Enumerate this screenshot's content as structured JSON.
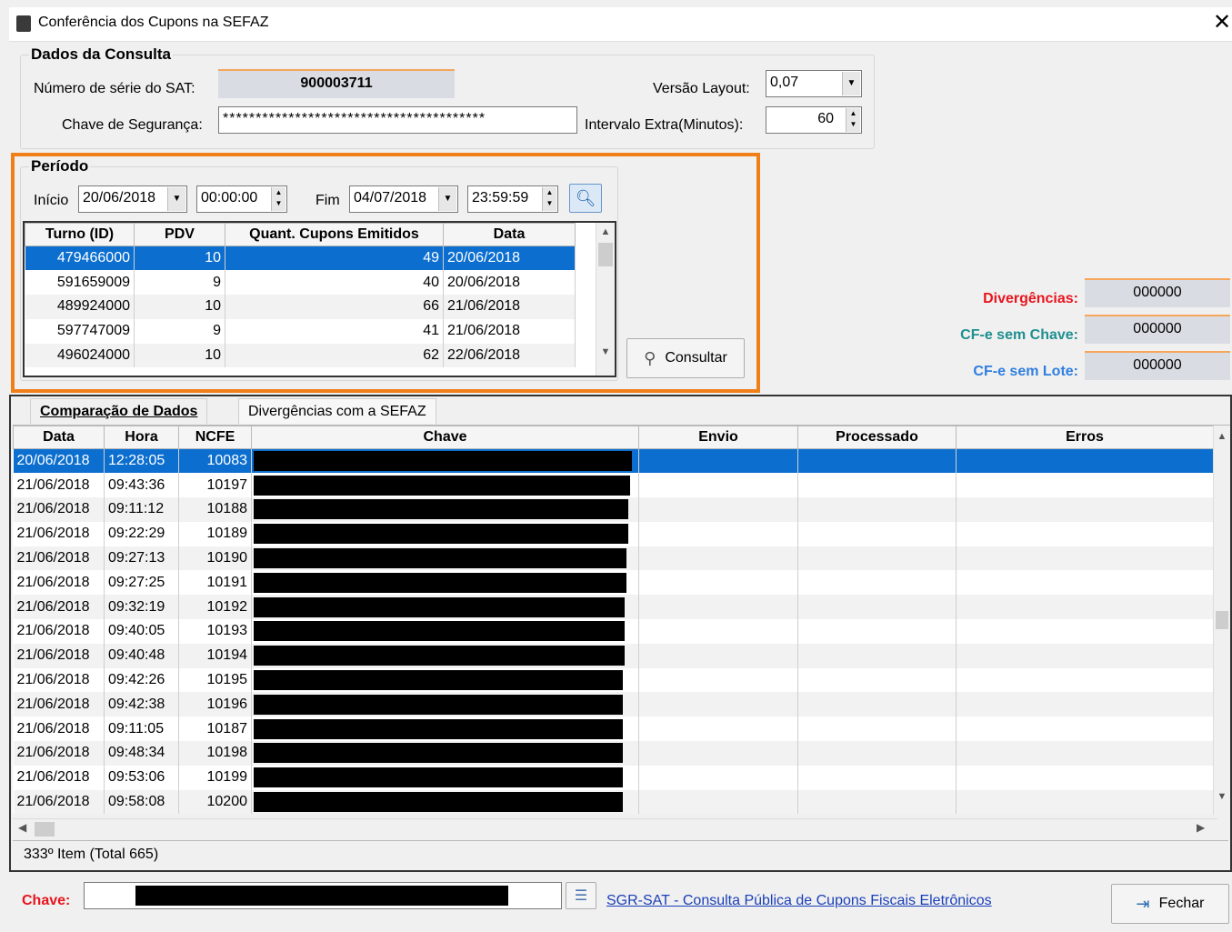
{
  "window": {
    "title": "Conferência dos Cupons na SEFAZ"
  },
  "consulta": {
    "group_label": "Dados da Consulta",
    "serie_label": "Número de série do SAT:",
    "serie_value": "900003711",
    "chave_label": "Chave de Segurança:",
    "chave_value": "****************************************",
    "versao_label": "Versão Layout:",
    "versao_value": "0,07",
    "intervalo_label": "Intervalo Extra(Minutos):",
    "intervalo_value": "60"
  },
  "periodo": {
    "group_label": "Período",
    "inicio_label": "Início",
    "inicio_date": "20/06/2018",
    "inicio_time": "00:00:00",
    "fim_label": "Fim",
    "fim_date": "04/07/2018",
    "fim_time": "23:59:59",
    "columns": [
      "Turno (ID)",
      "PDV",
      "Quant. Cupons Emitidos",
      "Data"
    ],
    "rows": [
      [
        "479466000",
        "10",
        "49",
        "20/06/2018"
      ],
      [
        "591659009",
        "9",
        "40",
        "20/06/2018"
      ],
      [
        "489924000",
        "10",
        "66",
        "21/06/2018"
      ],
      [
        "597747009",
        "9",
        "41",
        "21/06/2018"
      ],
      [
        "496024000",
        "10",
        "62",
        "22/06/2018"
      ]
    ]
  },
  "consultar_label": "Consultar",
  "stats": {
    "divergencias_label": "Divergências:",
    "divergencias_value": "000000",
    "sem_chave_label": "CF-e sem Chave:",
    "sem_chave_value": "000000",
    "sem_lote_label": "CF-e sem Lote:",
    "sem_lote_value": "000000",
    "colors": {
      "divergencias": "#e8141e",
      "sem_chave": "#1f8f8f",
      "sem_lote": "#2f7fe0"
    }
  },
  "tabs": [
    "Comparação de Dados",
    "Divergências com a SEFAZ"
  ],
  "comparacao": {
    "columns": [
      "Data",
      "Hora",
      "NCFE",
      "Chave",
      "Envio",
      "Processado",
      "Erros"
    ],
    "rows": [
      [
        "20/06/2018",
        "12:28:05",
        "10083"
      ],
      [
        "21/06/2018",
        "09:43:36",
        "10197"
      ],
      [
        "21/06/2018",
        "09:11:12",
        "10188"
      ],
      [
        "21/06/2018",
        "09:22:29",
        "10189"
      ],
      [
        "21/06/2018",
        "09:27:13",
        "10190"
      ],
      [
        "21/06/2018",
        "09:27:25",
        "10191"
      ],
      [
        "21/06/2018",
        "09:32:19",
        "10192"
      ],
      [
        "21/06/2018",
        "09:40:05",
        "10193"
      ],
      [
        "21/06/2018",
        "09:40:48",
        "10194"
      ],
      [
        "21/06/2018",
        "09:42:26",
        "10195"
      ],
      [
        "21/06/2018",
        "09:42:38",
        "10196"
      ],
      [
        "21/06/2018",
        "09:11:05",
        "10187"
      ],
      [
        "21/06/2018",
        "09:48:34",
        "10198"
      ],
      [
        "21/06/2018",
        "09:53:06",
        "10199"
      ],
      [
        "21/06/2018",
        "09:58:08",
        "10200"
      ]
    ],
    "status": "333º Item (Total 665)"
  },
  "footer": {
    "chave_label": "Chave:",
    "link_text": "SGR-SAT - Consulta Pública de Cupons Fiscais Eletrônicos",
    "fechar_label": "Fechar"
  }
}
